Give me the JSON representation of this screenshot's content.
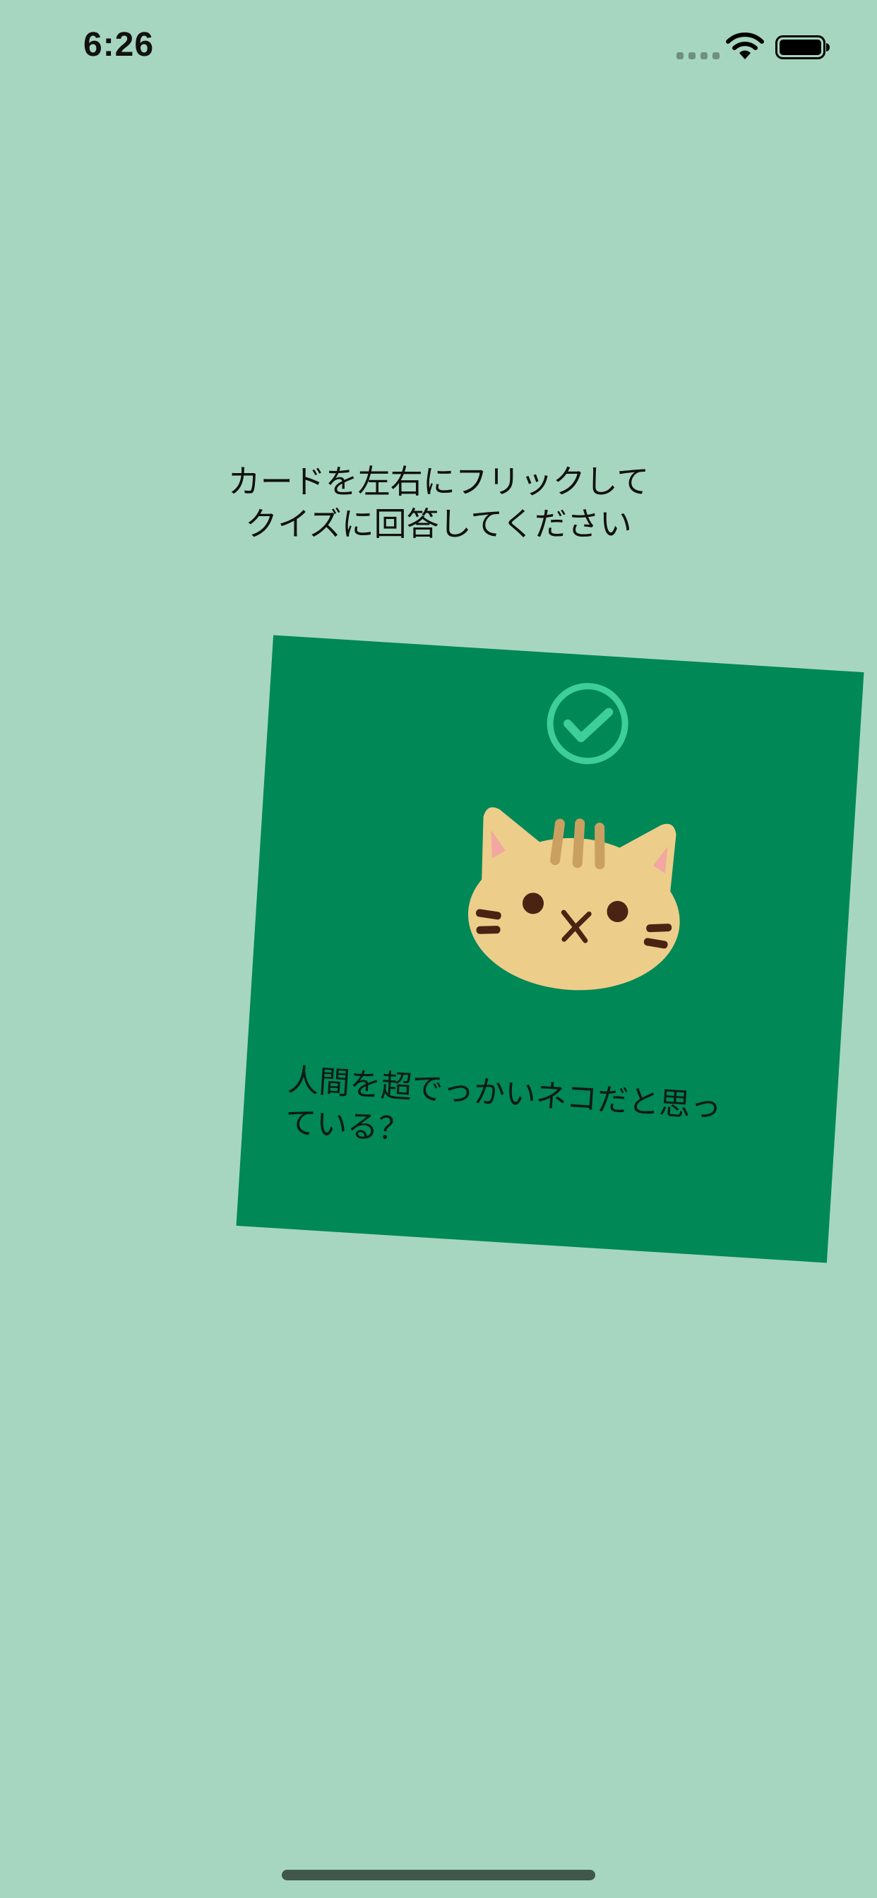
{
  "status_bar": {
    "time": "6:26",
    "icons": [
      "signal-icon",
      "wifi-icon",
      "battery-icon"
    ]
  },
  "instruction": {
    "line1": "カードを左右にフリックして",
    "line2": "クイズに回答してください"
  },
  "card": {
    "check_icon": "check-circle-icon",
    "image": "cat-face-icon",
    "question_line1": "人間を超でっかいネコだと思っ",
    "question_line2": "ている？"
  },
  "colors": {
    "background": "#a6d6bf",
    "card": "#008857",
    "check": "#3ecf99",
    "cat_face": "#edcd8a",
    "cat_stripe": "#caa061",
    "cat_ear_inner": "#f2a7a2",
    "cat_features": "#4a2312"
  }
}
